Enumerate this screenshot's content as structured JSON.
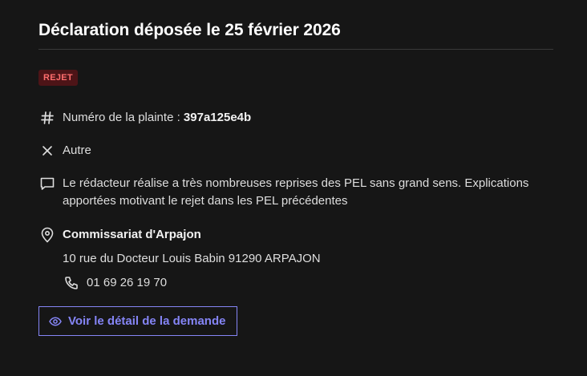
{
  "header": {
    "title": "Déclaration déposée le 25 février 2026"
  },
  "status": {
    "label": "REJET",
    "color": "#ff6e6e",
    "background": "#4d1417"
  },
  "complaint": {
    "number_label": "Numéro de la plainte :",
    "number_value": "397a125e4b",
    "icon": "hash-icon"
  },
  "category": {
    "label": "Autre",
    "icon": "close-icon"
  },
  "comment": {
    "text": "Le rédacteur réalise a très nombreuses reprises des PEL sans grand sens. Explications apportées motivant le rejet dans les PEL précédentes",
    "icon": "comment-icon"
  },
  "location": {
    "name": "Commissariat d'Arpajon",
    "address": "10 rue du Docteur Louis Babin 91290 ARPAJON",
    "phone": "01 69 26 19 70",
    "icon": "map-pin-icon",
    "phone_icon": "phone-icon"
  },
  "actions": {
    "detail_label": "Voir le détail de la demande",
    "detail_icon": "eye-icon",
    "accent": "#8585f6"
  }
}
